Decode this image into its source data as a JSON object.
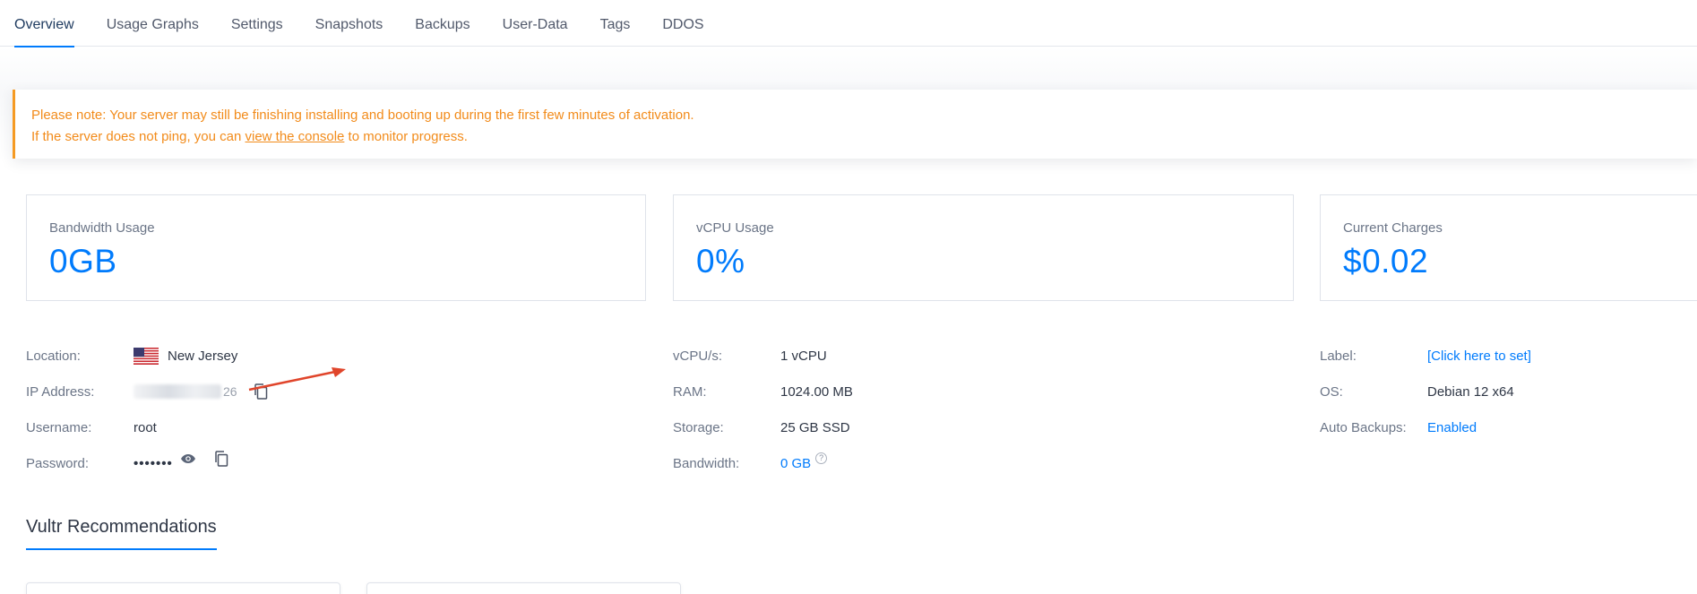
{
  "tabs": [
    {
      "label": "Overview",
      "active": true
    },
    {
      "label": "Usage Graphs"
    },
    {
      "label": "Settings"
    },
    {
      "label": "Snapshots"
    },
    {
      "label": "Backups"
    },
    {
      "label": "User-Data"
    },
    {
      "label": "Tags"
    },
    {
      "label": "DDOS"
    }
  ],
  "notice": {
    "line1": "Please note: Your server may still be finishing installing and booting up during the first few minutes of activation.",
    "line2_prefix": "If the server does not ping, you can ",
    "line2_link": "view the console",
    "line2_suffix": " to monitor progress."
  },
  "stats": {
    "bandwidth": {
      "label": "Bandwidth Usage",
      "value": "0GB"
    },
    "vcpu": {
      "label": "vCPU Usage",
      "value": "0%"
    },
    "charges": {
      "label": "Current Charges",
      "value": "$0.02"
    }
  },
  "server": {
    "location_label": "Location:",
    "location_value": "New Jersey",
    "ip_label": "IP Address:",
    "ip_visible_tail": "26",
    "username_label": "Username:",
    "username_value": "root",
    "password_label": "Password:",
    "password_value": "•••••••"
  },
  "specs": {
    "vcpu_label": "vCPU/s:",
    "vcpu_value": "1 vCPU",
    "ram_label": "RAM:",
    "ram_value": "1024.00 MB",
    "storage_label": "Storage:",
    "storage_value": "25 GB SSD",
    "bandwidth_label": "Bandwidth:",
    "bandwidth_value": "0 GB",
    "help_glyph": "?"
  },
  "meta": {
    "label_label": "Label:",
    "label_value": "[Click here to set]",
    "os_label": "OS:",
    "os_value": "Debian 12 x64",
    "backups_label": "Auto Backups:",
    "backups_value": "Enabled"
  },
  "recommendations": {
    "title": "Vultr Recommendations"
  },
  "icons": {
    "copy": "copy-icon",
    "eye": "eye-icon",
    "flag": "us-flag-icon",
    "help": "help-icon"
  },
  "colors": {
    "accent": "#007bfc",
    "warning": "#f28b1a",
    "annotation_arrow": "#e0452b"
  }
}
